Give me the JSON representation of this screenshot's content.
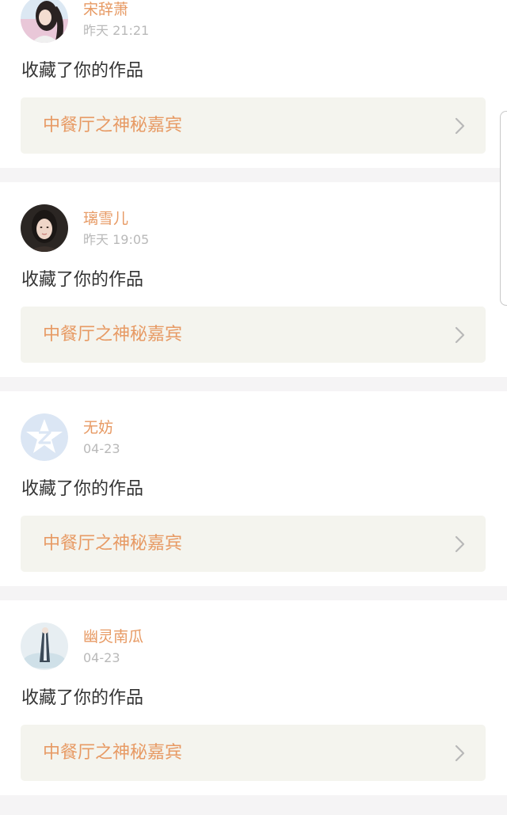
{
  "notifications": [
    {
      "username": "宋辞萧",
      "time": "昨天 21:21",
      "action": "收藏了你的作品",
      "work_title": "中餐厅之神秘嘉宾",
      "avatar_icon": "user-photo-avatar"
    },
    {
      "username": "璃雪儿",
      "time": "昨天 19:05",
      "action": "收藏了你的作品",
      "work_title": "中餐厅之神秘嘉宾",
      "avatar_icon": "user-photo-avatar"
    },
    {
      "username": "无妨",
      "time": "04-23",
      "action": "收藏了你的作品",
      "work_title": "中餐厅之神秘嘉宾",
      "avatar_icon": "default-star-avatar"
    },
    {
      "username": "幽灵南瓜",
      "time": "04-23",
      "action": "收藏了你的作品",
      "work_title": "中餐厅之神秘嘉宾",
      "avatar_icon": "user-photo-avatar"
    }
  ],
  "colors": {
    "username": "#e79a64",
    "work_title": "#e79a64",
    "timestamp": "#b9b9b9",
    "body_text": "#333333",
    "link_background": "#f4f4ee",
    "page_background": "#f5f4f5",
    "default_avatar": "#dbe6f4"
  }
}
